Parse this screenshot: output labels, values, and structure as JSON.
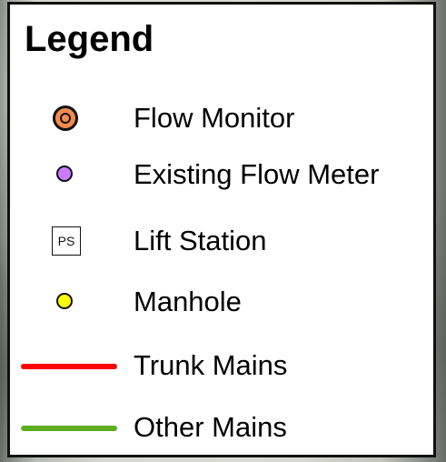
{
  "legend": {
    "title": "Legend",
    "items": [
      {
        "label": "Flow Monitor",
        "symbol": "orange-circle-icon",
        "color": "#f58a4d"
      },
      {
        "label": "Existing Flow Meter",
        "symbol": "purple-circle-icon",
        "color": "#c97bff"
      },
      {
        "label": "Lift Station",
        "symbol": "lift-station-box-icon",
        "symbol_text": "PS"
      },
      {
        "label": "Manhole",
        "symbol": "yellow-circle-icon",
        "color": "#ffff00"
      },
      {
        "label": "Trunk Mains",
        "symbol": "red-line-icon",
        "color": "#ff0000"
      },
      {
        "label": "Other Mains",
        "symbol": "green-line-icon",
        "color": "#5dad1f"
      }
    ]
  }
}
